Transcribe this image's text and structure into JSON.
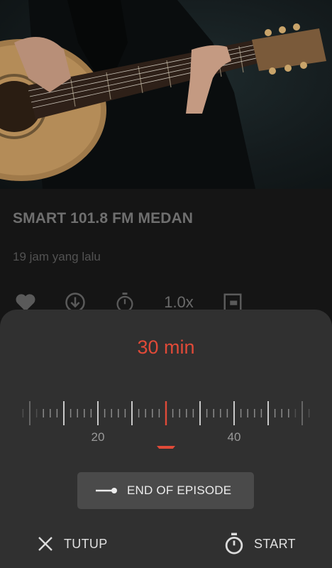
{
  "episode": {
    "title": "SMART 101.8 FM MEDAN",
    "time_ago": "19 jam yang lalu"
  },
  "actions": {
    "like_icon": "heart-icon",
    "download_icon": "download-icon",
    "timer_icon": "stopwatch-icon",
    "speed": "1.0x",
    "queue_icon": "playlist-icon"
  },
  "sleep_timer": {
    "duration": "30 min",
    "ruler_labels": [
      "20",
      "40"
    ],
    "selected_minutes": 30,
    "end_of_episode_label": "END OF EPISODE",
    "close_label": "TUTUP",
    "start_label": "START"
  },
  "colors": {
    "accent": "#e04a38",
    "sheet_bg": "#303030",
    "button_bg": "#4a4a4a"
  }
}
